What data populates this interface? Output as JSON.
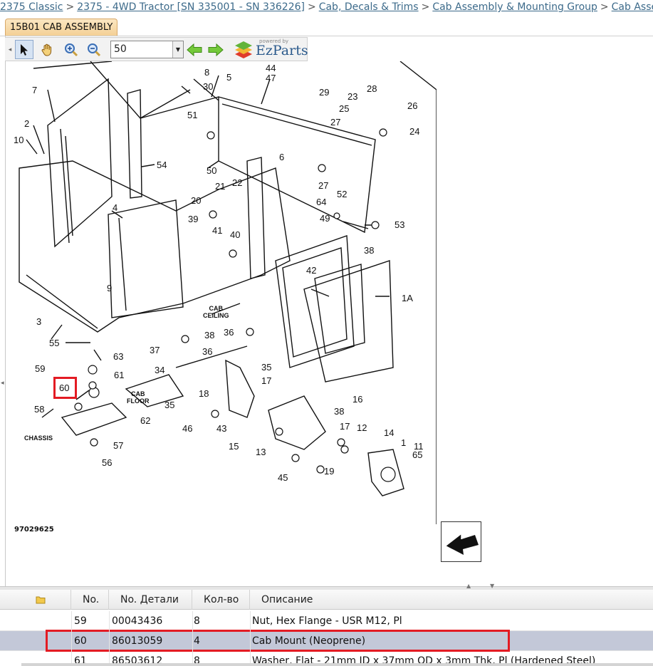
{
  "breadcrumb": [
    "2375 Classic",
    "2375 - 4WD Tractor [SN 335001 - SN 336226]",
    "Cab, Decals & Trims",
    "Cab Assembly & Mounting Group",
    "Cab Asse"
  ],
  "breadcrumb_separator": ">",
  "tab": {
    "label": "15B01 CAB ASSEMBLY"
  },
  "toolbar": {
    "zoom_value": "50",
    "logo_powered": "powered by",
    "logo_name": "EzParts"
  },
  "diagram": {
    "figure_number": "97029625",
    "labels": {
      "cab_ceiling": "CAB\nCEILING",
      "cab_floor": "CAB\nFLOOR",
      "chassis": "CHASSIS"
    },
    "callouts": [
      "44",
      "47",
      "8",
      "30",
      "5",
      "29",
      "23",
      "28",
      "7",
      "51",
      "26",
      "25",
      "27",
      "24",
      "2",
      "10",
      "6",
      "54",
      "50",
      "27",
      "52",
      "53",
      "49",
      "64",
      "21",
      "22",
      "20",
      "38",
      "4",
      "39",
      "41",
      "40",
      "42",
      "1A",
      "9",
      "3",
      "CAB",
      "36",
      "55",
      "63",
      "38",
      "37",
      "36",
      "34",
      "35",
      "59",
      "61",
      "60",
      "58",
      "62",
      "57",
      "56",
      "18",
      "17",
      "16",
      "35",
      "46",
      "43",
      "15",
      "38",
      "17",
      "12",
      "14",
      "1",
      "11",
      "65",
      "13",
      "45",
      "19"
    ],
    "highlighted_callout": "60"
  },
  "grid": {
    "headers": {
      "icon": "folder-icon",
      "no": "No.",
      "part_no": "No. Детали",
      "qty": "Кол-во",
      "description": "Описание"
    },
    "partial_top_row": {
      "description": ""
    },
    "rows": [
      {
        "no": "59",
        "part_no": "00043436",
        "qty": "8",
        "description": "Nut, Hex Flange - USR M12, Pl"
      },
      {
        "no": "60",
        "part_no": "86013059",
        "qty": "4",
        "description": "Cab Mount (Neoprene)"
      },
      {
        "no": "61",
        "part_no": "86503612",
        "qty": "8",
        "description": "Washer, Flat - 21mm ID x 37mm OD x 3mm Thk, Pl (Hardened Steel)"
      }
    ],
    "selected_row_no": "60"
  },
  "colors": {
    "highlight": "#e31b23",
    "selected_row": "#c3c8d8",
    "link": "#3c6a8a",
    "tab": "#f3cf93"
  }
}
